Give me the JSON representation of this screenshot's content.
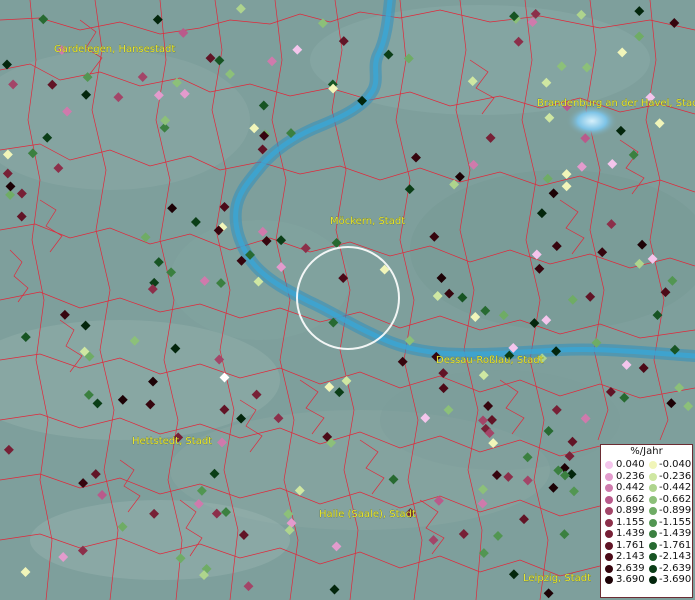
{
  "legend": {
    "title": "%/Jahr",
    "positive": [
      {
        "value": "0.040",
        "color": "#f4c5ec"
      },
      {
        "value": "0.236",
        "color": "#e39bcd"
      },
      {
        "value": "0.442",
        "color": "#cf7aac"
      },
      {
        "value": "0.662",
        "color": "#b95a8b"
      },
      {
        "value": "0.899",
        "color": "#a34568"
      },
      {
        "value": "1.155",
        "color": "#8c2f4a"
      },
      {
        "value": "1.439",
        "color": "#772036"
      },
      {
        "value": "1.761",
        "color": "#611426"
      },
      {
        "value": "2.143",
        "color": "#4c0a18"
      },
      {
        "value": "2.639",
        "color": "#36050e"
      },
      {
        "value": "3.690",
        "color": "#1d0206"
      }
    ],
    "negative": [
      {
        "value": "-0.040",
        "color": "#f1f5b9"
      },
      {
        "value": "-0.236",
        "color": "#cfe7a2"
      },
      {
        "value": "-0.442",
        "color": "#aed48d"
      },
      {
        "value": "-0.662",
        "color": "#8cc079"
      },
      {
        "value": "-0.899",
        "color": "#6fac65"
      },
      {
        "value": "-1.155",
        "color": "#529652"
      },
      {
        "value": "-1.439",
        "color": "#3b8040"
      },
      {
        "value": "-1.761",
        "color": "#276a31"
      },
      {
        "value": "-2.143",
        "color": "#175423"
      },
      {
        "value": "-2.639",
        "color": "#0b3e17"
      },
      {
        "value": "-3.690",
        "color": "#03260c"
      }
    ]
  },
  "cities": [
    {
      "name": "Gardelegen, Hansestadt"
    },
    {
      "name": "Brandenburg an der Havel, Stadt"
    },
    {
      "name": "Möckern, Stadt"
    },
    {
      "name": "Dessau-Roßlau, Stadt"
    },
    {
      "name": "Hettstedt, Stadt"
    },
    {
      "name": "Halle (Saale), Stadt"
    },
    {
      "name": "Leipzig, Stadt"
    }
  ],
  "colors": {
    "background": "#7e9f9c",
    "river": "#2f8fc0",
    "boundary": "#e0283a",
    "selection_ring": "#ffffff"
  }
}
